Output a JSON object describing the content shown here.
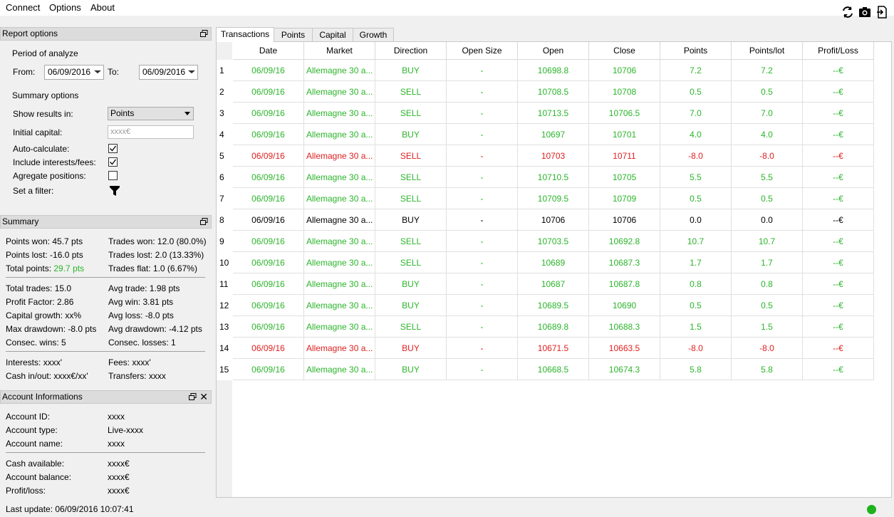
{
  "menu": {
    "items": [
      "Connect",
      "Options",
      "About"
    ]
  },
  "toolbar": {
    "icons": [
      "refresh-icon",
      "camera-icon",
      "export-icon"
    ]
  },
  "report_options": {
    "title": "Report options",
    "period_label": "Period of analyze",
    "from_label": "From:",
    "from_value": "06/09/2016",
    "to_label": "To:",
    "to_value": "06/09/2016",
    "summary_options_label": "Summary options",
    "show_results_label": "Show results in:",
    "show_results_value": "Points",
    "initial_capital_label": "Initial capital:",
    "initial_capital_placeholder": "xxxx€",
    "auto_calculate_label": "Auto-calculate:",
    "auto_calculate_checked": true,
    "include_fees_label": "Include interests/fees:",
    "include_fees_checked": true,
    "aggregate_label": "Agregate positions:",
    "aggregate_checked": false,
    "filter_label": "Set a filter:"
  },
  "summary": {
    "title": "Summary",
    "points_won": "Points won: 45.7 pts",
    "points_lost": "Points lost: -16.0 pts",
    "total_points_label": "Total points: ",
    "total_points_value": "29.7 pts",
    "trades_won": "Trades won: 12.0 (80.0%)",
    "trades_lost": "Trades lost: 2.0 (13.33%)",
    "trades_flat": "Trades flat: 1.0 (6.67%)",
    "total_trades": "Total trades: 15.0",
    "profit_factor": "Profit Factor: 2.86",
    "capital_growth": "Capital growth: xx%",
    "max_drawdown": "Max drawdown: -8.0 pts",
    "consec_wins": "Consec. wins: 5",
    "avg_trade": "Avg trade: 1.98 pts",
    "avg_win": "Avg win: 3.81 pts",
    "avg_loss": "Avg loss: -8.0 pts",
    "avg_drawdown": "Avg drawdown: -4.12 pts",
    "consec_losses": "Consec. losses: 1",
    "interests": "Interests: xxxx'",
    "fees": "Fees: xxxx'",
    "cash_inout": "Cash in/out: xxxx€/xx'",
    "transfers": "Transfers: xxxx"
  },
  "account": {
    "title": "Account Informations",
    "id_label": "Account ID:",
    "id_value": "xxxx",
    "type_label": "Account type:",
    "type_value": "Live-xxxx",
    "name_label": "Account name:",
    "name_value": "xxxx",
    "cash_label": "Cash available:",
    "cash_value": "xxxx€",
    "balance_label": "Account balance:",
    "balance_value": "xxxx€",
    "pl_label": "Profit/loss:",
    "pl_value": "xxxx€"
  },
  "tabs": [
    "Transactions",
    "Points",
    "Capital",
    "Growth"
  ],
  "table": {
    "columns": [
      "Date",
      "Market",
      "Direction",
      "Open Size",
      "Open",
      "Close",
      "Points",
      "Points/lot",
      "Profit/Loss"
    ],
    "rows": [
      {
        "n": "1",
        "status": "win",
        "cells": [
          "06/09/16",
          "Allemagne 30 a...",
          "BUY",
          "-",
          "10698.8",
          "10706",
          "7.2",
          "7.2",
          "--€"
        ]
      },
      {
        "n": "2",
        "status": "win",
        "cells": [
          "06/09/16",
          "Allemagne 30 a...",
          "SELL",
          "-",
          "10708.5",
          "10708",
          "0.5",
          "0.5",
          "--€"
        ]
      },
      {
        "n": "3",
        "status": "win",
        "cells": [
          "06/09/16",
          "Allemagne 30 a...",
          "SELL",
          "-",
          "10713.5",
          "10706.5",
          "7.0",
          "7.0",
          "--€"
        ]
      },
      {
        "n": "4",
        "status": "win",
        "cells": [
          "06/09/16",
          "Allemagne 30 a...",
          "BUY",
          "-",
          "10697",
          "10701",
          "4.0",
          "4.0",
          "--€"
        ]
      },
      {
        "n": "5",
        "status": "loss",
        "cells": [
          "06/09/16",
          "Allemagne 30 a...",
          "SELL",
          "-",
          "10703",
          "10711",
          "-8.0",
          "-8.0",
          "--€"
        ]
      },
      {
        "n": "6",
        "status": "win",
        "cells": [
          "06/09/16",
          "Allemagne 30 a...",
          "SELL",
          "-",
          "10710.5",
          "10705",
          "5.5",
          "5.5",
          "--€"
        ]
      },
      {
        "n": "7",
        "status": "win",
        "cells": [
          "06/09/16",
          "Allemagne 30 a...",
          "SELL",
          "-",
          "10709.5",
          "10709",
          "0.5",
          "0.5",
          "--€"
        ]
      },
      {
        "n": "8",
        "status": "flat",
        "cells": [
          "06/09/16",
          "Allemagne 30 a...",
          "BUY",
          "-",
          "10706",
          "10706",
          "0.0",
          "0.0",
          "--€"
        ]
      },
      {
        "n": "9",
        "status": "win",
        "cells": [
          "06/09/16",
          "Allemagne 30 a...",
          "SELL",
          "-",
          "10703.5",
          "10692.8",
          "10.7",
          "10.7",
          "--€"
        ]
      },
      {
        "n": "10",
        "status": "win",
        "cells": [
          "06/09/16",
          "Allemagne 30 a...",
          "SELL",
          "-",
          "10689",
          "10687.3",
          "1.7",
          "1.7",
          "--€"
        ]
      },
      {
        "n": "11",
        "status": "win",
        "cells": [
          "06/09/16",
          "Allemagne 30 a...",
          "BUY",
          "-",
          "10687",
          "10687.8",
          "0.8",
          "0.8",
          "--€"
        ]
      },
      {
        "n": "12",
        "status": "win",
        "cells": [
          "06/09/16",
          "Allemagne 30 a...",
          "BUY",
          "-",
          "10689.5",
          "10690",
          "0.5",
          "0.5",
          "--€"
        ]
      },
      {
        "n": "13",
        "status": "win",
        "cells": [
          "06/09/16",
          "Allemagne 30 a...",
          "SELL",
          "-",
          "10689.8",
          "10688.3",
          "1.5",
          "1.5",
          "--€"
        ]
      },
      {
        "n": "14",
        "status": "loss",
        "cells": [
          "06/09/16",
          "Allemagne 30 a...",
          "BUY",
          "-",
          "10671.5",
          "10663.5",
          "-8.0",
          "-8.0",
          "--€"
        ]
      },
      {
        "n": "15",
        "status": "win",
        "cells": [
          "06/09/16",
          "Allemagne 30 a...",
          "BUY",
          "-",
          "10668.5",
          "10674.3",
          "5.8",
          "5.8",
          "--€"
        ]
      }
    ]
  },
  "colors": {
    "win": "#2bb52b",
    "loss": "#e02020",
    "flat": "#000000",
    "connected": "#1db31d"
  },
  "status": {
    "last_update": "Last update: 06/09/2016 10:07:41"
  }
}
